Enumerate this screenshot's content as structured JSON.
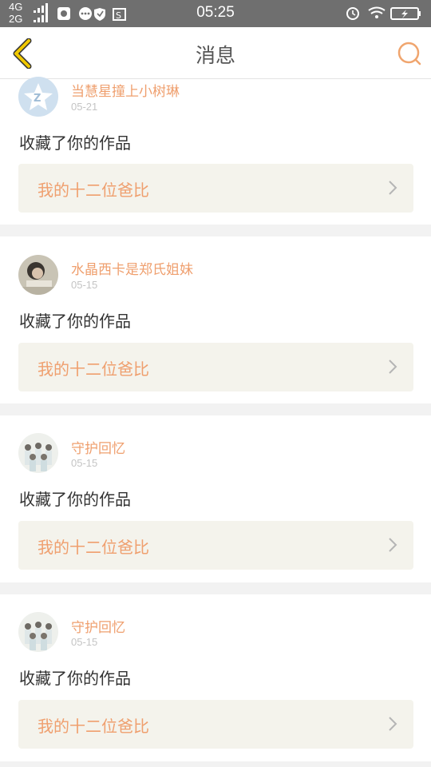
{
  "status_bar": {
    "network_top": "4G",
    "network_bottom": "2G",
    "time": "05:25",
    "icons": [
      "qq-icon",
      "message-icon",
      "shield-icon",
      "screenshot-icon"
    ],
    "right_icons": [
      "alarm-icon",
      "wifi-icon",
      "battery-charging-icon"
    ]
  },
  "header": {
    "title": "消息",
    "back_icon": "chevron-left-icon",
    "search_icon": "search-icon",
    "accent_color": "#ef9f6e",
    "back_color": "#e8b800"
  },
  "messages": [
    {
      "user": "当慧星撞上小树琳",
      "date": "05-21",
      "action": "收藏了你的作品",
      "work": "我的十二位爸比",
      "avatar": "default-qq-avatar"
    },
    {
      "user": "水晶西卡是郑氏姐妹",
      "date": "05-15",
      "action": "收藏了你的作品",
      "work": "我的十二位爸比",
      "avatar": "photo-avatar-girl"
    },
    {
      "user": "守护回忆",
      "date": "05-15",
      "action": "收藏了你的作品",
      "work": "我的十二位爸比",
      "avatar": "photo-avatar-group"
    },
    {
      "user": "守护回忆",
      "date": "05-15",
      "action": "收藏了你的作品",
      "work": "我的十二位爸比",
      "avatar": "photo-avatar-group"
    }
  ]
}
